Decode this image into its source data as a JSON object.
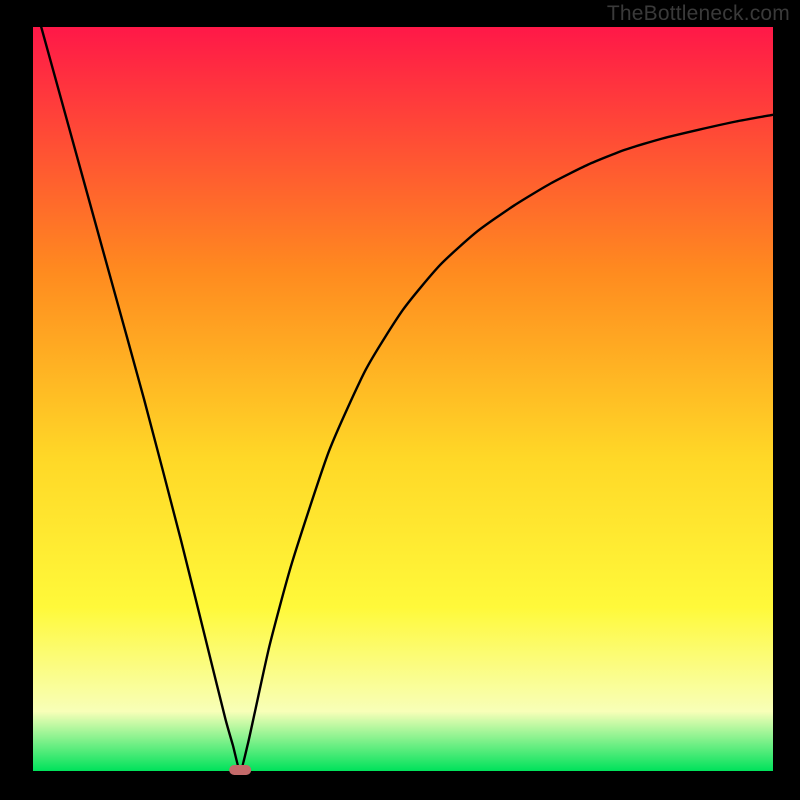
{
  "watermark": "TheBottleneck.com",
  "chart_data": {
    "type": "line",
    "title": "",
    "xlabel": "",
    "ylabel": "",
    "xlim": [
      0,
      100
    ],
    "ylim": [
      0,
      100
    ],
    "grid": false,
    "legend": false,
    "background_gradient": {
      "top": "#ff1848",
      "upper_mid": "#ff8b1f",
      "mid": "#ffd827",
      "lower_mid": "#fff93a",
      "bottom_band": "#f8ffb8",
      "bottom": "#00e25b"
    },
    "marker": {
      "x": 28,
      "y": 0,
      "color": "#c46a6a",
      "shape": "pill"
    },
    "series": [
      {
        "name": "curve",
        "x": [
          0,
          5,
          10,
          15,
          20,
          24,
          26,
          27,
          28,
          29,
          30,
          32,
          35,
          40,
          45,
          50,
          55,
          60,
          65,
          70,
          75,
          80,
          85,
          90,
          95,
          100
        ],
        "y": [
          104,
          86,
          68,
          50,
          31,
          15,
          7,
          3.5,
          0,
          3.5,
          8,
          17,
          28,
          43,
          54,
          62,
          68,
          72.5,
          76,
          79,
          81.5,
          83.5,
          85,
          86.2,
          87.3,
          88.2
        ]
      }
    ]
  }
}
